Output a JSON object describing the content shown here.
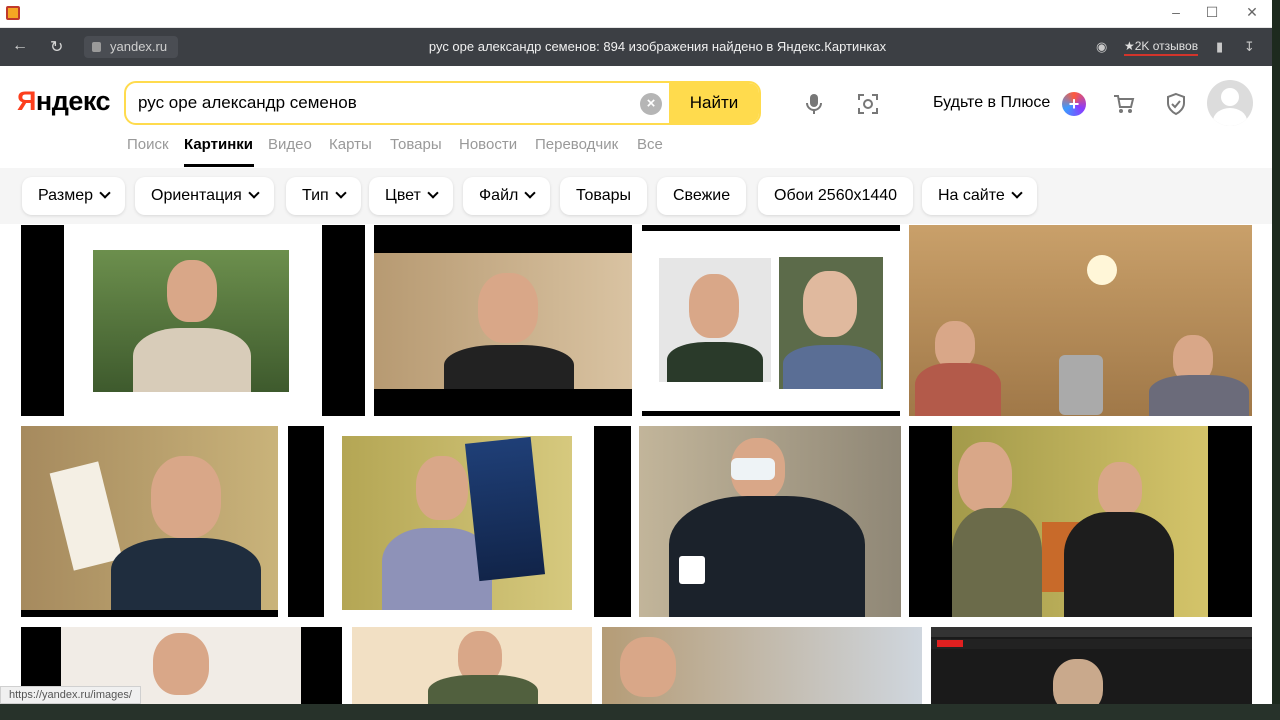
{
  "window": {
    "min_icon": "minimize-icon",
    "max_icon": "maximize-icon",
    "close_icon": "close-icon"
  },
  "browser": {
    "url": "yandex.ru",
    "page_title": "рус оре александр семенов: 894 изображения найдено в Яндекс.Картинках",
    "reviews": "★2K отзывов"
  },
  "header": {
    "logo_first": "Я",
    "logo_rest": "ндекс",
    "search_value": "рус оре александр семенов",
    "search_button": "Найти",
    "plus_text": "Будьте в Плюсе",
    "plus_symbol": "+"
  },
  "tabs": [
    {
      "label": "Поиск",
      "active": false
    },
    {
      "label": "Картинки",
      "active": true
    },
    {
      "label": "Видео",
      "active": false
    },
    {
      "label": "Карты",
      "active": false
    },
    {
      "label": "Товары",
      "active": false
    },
    {
      "label": "Новости",
      "active": false
    },
    {
      "label": "Переводчик",
      "active": false
    },
    {
      "label": "Все",
      "active": false
    }
  ],
  "filters": [
    {
      "label": "Размер",
      "dropdown": true
    },
    {
      "label": "Ориентация",
      "dropdown": true
    },
    {
      "label": "Тип",
      "dropdown": true
    },
    {
      "label": "Цвет",
      "dropdown": true
    },
    {
      "label": "Файл",
      "dropdown": true
    },
    {
      "label": "Товары",
      "dropdown": false
    },
    {
      "label": "Свежие",
      "dropdown": false
    },
    {
      "label": "Обои 2560x1440",
      "dropdown": false
    },
    {
      "label": "На сайте",
      "dropdown": true
    }
  ],
  "status_url": "https://yandex.ru/images/",
  "colors": {
    "accent_yellow": "#ffdb4d",
    "logo_red": "#fc3f1d",
    "browser_bar": "#3c3f44"
  }
}
